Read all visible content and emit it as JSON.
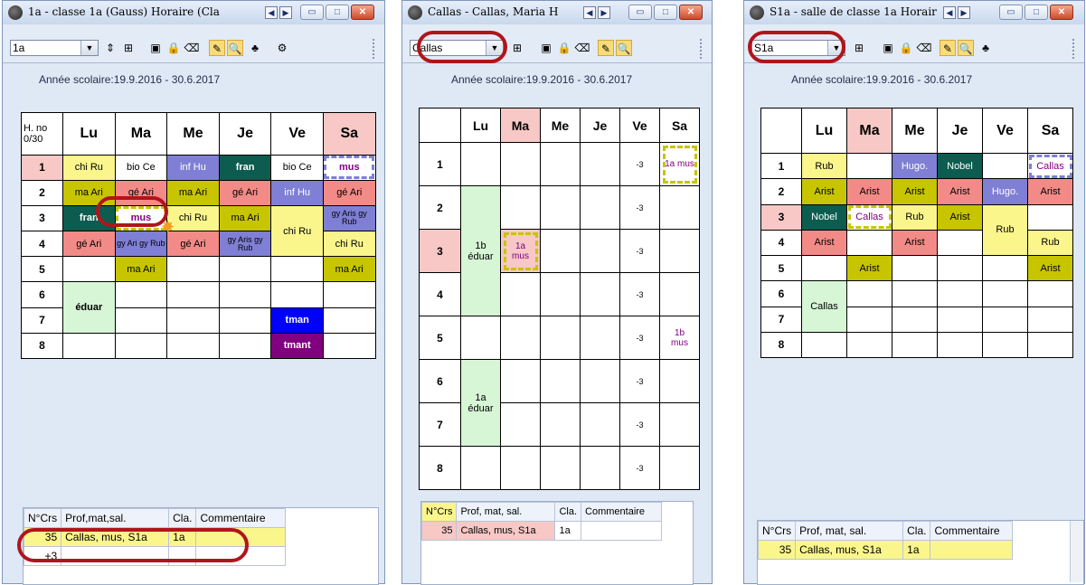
{
  "windows": [
    {
      "title": "1a - classe 1a (Gauss)  Horaire  (Cla",
      "combo_value": "1a",
      "annee": "Année scolaire:19.9.2016 - 30.6.2017",
      "corner": "H. no 0/30",
      "days": [
        "Lu",
        "Ma",
        "Me",
        "Je",
        "Ve",
        "Sa"
      ],
      "periods": [
        "1",
        "2",
        "3",
        "4",
        "5",
        "6",
        "7",
        "8"
      ],
      "lessons": [
        "chi Ru",
        "bio Ce",
        "inf Hu",
        "fran",
        "bio Ce",
        "mus",
        "ma Ari",
        "gé Ari",
        "ma Ari",
        "gé Ari",
        "inf Hu",
        "gé Ari",
        "fran",
        "mus",
        "chi Ru",
        "ma Ari",
        "gy Aris gy Rub",
        "gé Ari",
        "gy Ari gy Rub",
        "gé Ari",
        "gy Aris gy Rub",
        "chi Ru",
        "chi Ru",
        "ma Ari",
        "ma Ari",
        "éduar",
        "tman",
        "tmant"
      ],
      "bottom": {
        "headers": [
          "N°Crs",
          "Prof,mat,sal.",
          "Cla.",
          "Commentaire"
        ],
        "row": {
          "num": "35",
          "prof": "Callas, mus, S1a",
          "cla": "1a",
          "comm": ""
        },
        "row2": "+3"
      }
    },
    {
      "title": "Callas - Callas, Maria  H",
      "combo_value": "Callas",
      "annee": "Année scolaire:19.9.2016 - 30.6.2017",
      "days": [
        "Lu",
        "Ma",
        "Me",
        "Je",
        "Ve",
        "Sa"
      ],
      "periods": [
        "1",
        "2",
        "3",
        "4",
        "5",
        "6",
        "7",
        "8"
      ],
      "lessons": [
        "-3",
        "1a mus",
        "-3",
        "1b éduar",
        "1a mus",
        "-3",
        "-3",
        "-3",
        "1b mus",
        "1a éduar",
        "-3",
        "-3",
        "-3"
      ],
      "bottom": {
        "headers": [
          "N°Crs",
          "Prof, mat, sal.",
          "Cla.",
          "Commentaire"
        ],
        "row": {
          "num": "35",
          "prof": "Callas, mus, S1a",
          "cla": "1a",
          "comm": ""
        }
      }
    },
    {
      "title": "S1a - salle de classe 1a  Horair",
      "combo_value": "S1a",
      "annee": "Année scolaire:19.9.2016 - 30.6.2017",
      "days": [
        "Lu",
        "Ma",
        "Me",
        "Je",
        "Ve",
        "Sa"
      ],
      "periods": [
        "1",
        "2",
        "3",
        "4",
        "5",
        "6",
        "7",
        "8"
      ],
      "lessons": [
        "Rub",
        "Hugo.",
        "Nobel",
        "Callas",
        "Arist",
        "Arist",
        "Arist",
        "Arist",
        "Hugo.",
        "Arist",
        "Nobel",
        "Callas",
        "Rub",
        "Arist",
        "Rub",
        "Arist",
        "Arist",
        "Rub",
        "Arist",
        "Arist",
        "Callas"
      ],
      "bottom": {
        "headers": [
          "N°Crs",
          "Prof, mat, sal.",
          "Cla.",
          "Commentaire"
        ],
        "row": {
          "num": "35",
          "prof": "Callas, mus, S1a",
          "cla": "1a",
          "comm": ""
        }
      }
    }
  ],
  "icons": {
    "nav_prev": "◀",
    "nav_next": "▶",
    "minimize": "▭",
    "maximize": "□",
    "close": "✕",
    "dropdown": "▼",
    "spin": "⇕",
    "grid_tool": "⊞",
    "save_tool": "▣",
    "lock_tool": "🔒",
    "eraser_tool": "⌫",
    "pencil_tool": "✎",
    "search_tool": "🔍",
    "person_tool": "♣",
    "settings_tool": "⚙"
  },
  "colors": {
    "yellow": "#faf68c",
    "olive": "#c7c500",
    "salmon": "#f28b87",
    "purple_blue": "#7f7fd5",
    "dark_green": "#0c5c4f",
    "light_green": "#d6f6d6",
    "blue": "#0000ff",
    "purple": "#800080",
    "header_pink": "#f7c8c5",
    "highlight": "#b0151b"
  }
}
